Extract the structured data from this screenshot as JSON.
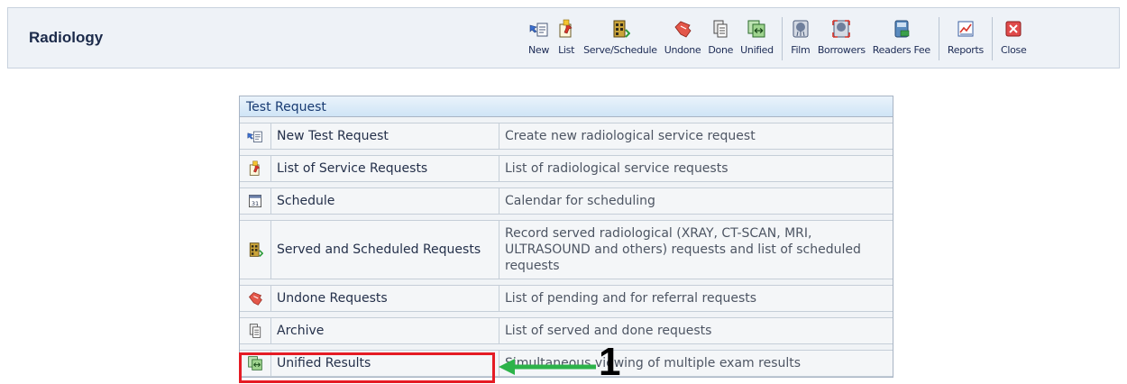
{
  "app": {
    "title": "Radiology"
  },
  "toolbar": [
    {
      "label": "New",
      "icon": "new-request-icon"
    },
    {
      "label": "List",
      "icon": "list-icon"
    },
    {
      "label": "Serve/Schedule",
      "icon": "serve-schedule-icon"
    },
    {
      "label": "Undone",
      "icon": "undone-icon"
    },
    {
      "label": "Done",
      "icon": "done-icon"
    },
    {
      "label": "Unified",
      "icon": "unified-icon"
    },
    {
      "label": "Film",
      "icon": "film-icon"
    },
    {
      "label": "Borrowers",
      "icon": "borrowers-icon"
    },
    {
      "label": "Readers Fee",
      "icon": "readers-fee-icon"
    },
    {
      "label": "Reports",
      "icon": "reports-icon"
    },
    {
      "label": "Close",
      "icon": "close-icon"
    }
  ],
  "menu": {
    "caption": "Test Request",
    "rows": [
      {
        "name": "New Test Request",
        "desc": "Create new radiological service request",
        "icon": "new-request-icon"
      },
      {
        "name": "List of Service Requests",
        "desc": "List of radiological service requests",
        "icon": "list-icon"
      },
      {
        "name": "Schedule",
        "desc": "Calendar for scheduling",
        "icon": "calendar-icon"
      },
      {
        "name": "Served and Scheduled Requests",
        "desc": "Record served radiological (XRAY, CT-SCAN, MRI, ULTRASOUND and others) requests and list of scheduled requests",
        "icon": "serve-schedule-icon"
      },
      {
        "name": "Undone Requests",
        "desc": "List of pending and for referral requests",
        "icon": "undone-icon"
      },
      {
        "name": "Archive",
        "desc": "List of served and done requests",
        "icon": "archive-icon"
      },
      {
        "name": "Unified Results",
        "desc": "Simultaneous viewing of multiple exam results",
        "icon": "unified-icon"
      }
    ]
  },
  "annotation": {
    "step": "1",
    "highlight_color": "#e51b24",
    "arrow_color": "#2db34a"
  }
}
